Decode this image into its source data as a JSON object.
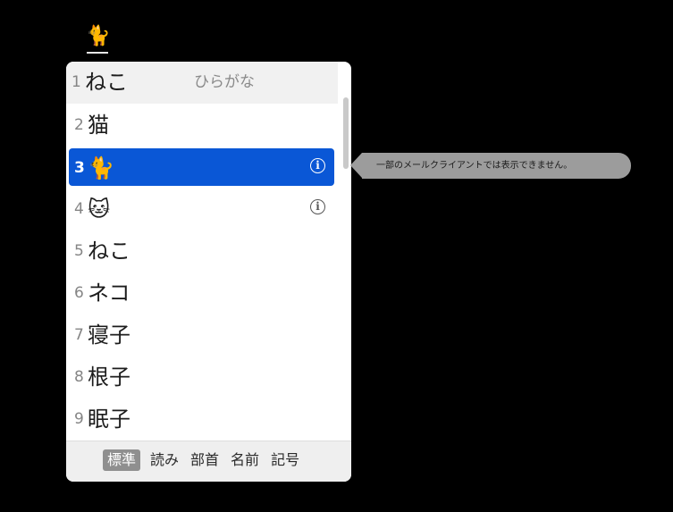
{
  "composition": {
    "text": "🐈"
  },
  "candidates": [
    {
      "number": "1",
      "text": "ねこ",
      "hint": "ひらがな",
      "info": false,
      "selected": false
    },
    {
      "number": "2",
      "text": "猫",
      "info": false,
      "selected": false
    },
    {
      "number": "3",
      "text": "🐈",
      "info": true,
      "selected": true
    },
    {
      "number": "4",
      "text": "🐱",
      "info": true,
      "selected": false
    },
    {
      "number": "5",
      "text": "ねこ",
      "info": false,
      "selected": false
    },
    {
      "number": "6",
      "text": "ネコ",
      "info": false,
      "selected": false
    },
    {
      "number": "7",
      "text": "寝子",
      "info": false,
      "selected": false
    },
    {
      "number": "8",
      "text": "根子",
      "info": false,
      "selected": false
    },
    {
      "number": "9",
      "text": "眠子",
      "info": false,
      "selected": false
    }
  ],
  "info_icon": {
    "glyph": "i",
    "icon": "info-icon"
  },
  "footer": {
    "tabs": [
      {
        "label": "標準",
        "active": true
      },
      {
        "label": "読み",
        "active": false
      },
      {
        "label": "部首",
        "active": false
      },
      {
        "label": "名前",
        "active": false
      },
      {
        "label": "記号",
        "active": false
      }
    ]
  },
  "tooltip": {
    "text": "一部のメールクライアントでは表示できません。"
  },
  "colors": {
    "selection": "#0a57d6",
    "background": "#000000",
    "tooltip": "#9c9c9c"
  }
}
